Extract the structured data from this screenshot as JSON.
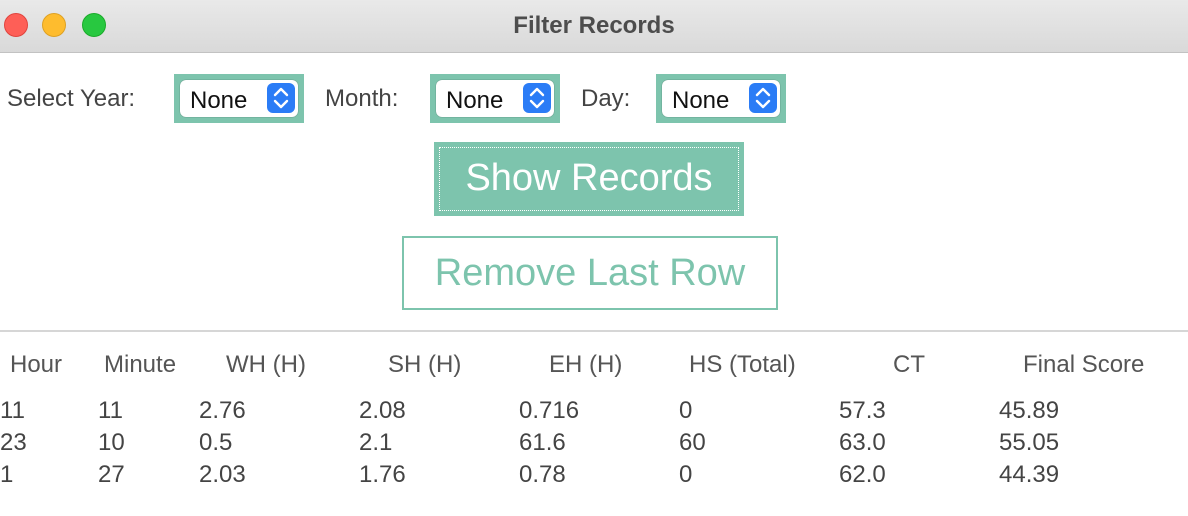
{
  "window": {
    "title": "Filter Records"
  },
  "filters": {
    "year_label": "Select Year:",
    "year_value": "None",
    "month_label": "Month:",
    "month_value": "None",
    "day_label": "Day:",
    "day_value": "None"
  },
  "buttons": {
    "show_records": "Show Records",
    "remove_last_row": "Remove Last Row"
  },
  "colors": {
    "accent": "#7dc4ad",
    "select_arrow_bg": "#2b7cf6"
  },
  "table": {
    "columns": [
      "Hour",
      "Minute",
      "WH (H)",
      "SH (H)",
      "EH (H)",
      "HS (Total)",
      "CT",
      "Final Score"
    ],
    "rows": [
      [
        "11",
        "11",
        "2.76",
        "2.08",
        "0.716",
        "0",
        "57.3",
        "45.89"
      ],
      [
        "23",
        "10",
        "0.5",
        "2.1",
        "61.6",
        "60",
        "63.0",
        "55.05"
      ],
      [
        "1",
        "27",
        "2.03",
        "1.76",
        "0.78",
        "0",
        "62.0",
        "44.39"
      ]
    ]
  }
}
